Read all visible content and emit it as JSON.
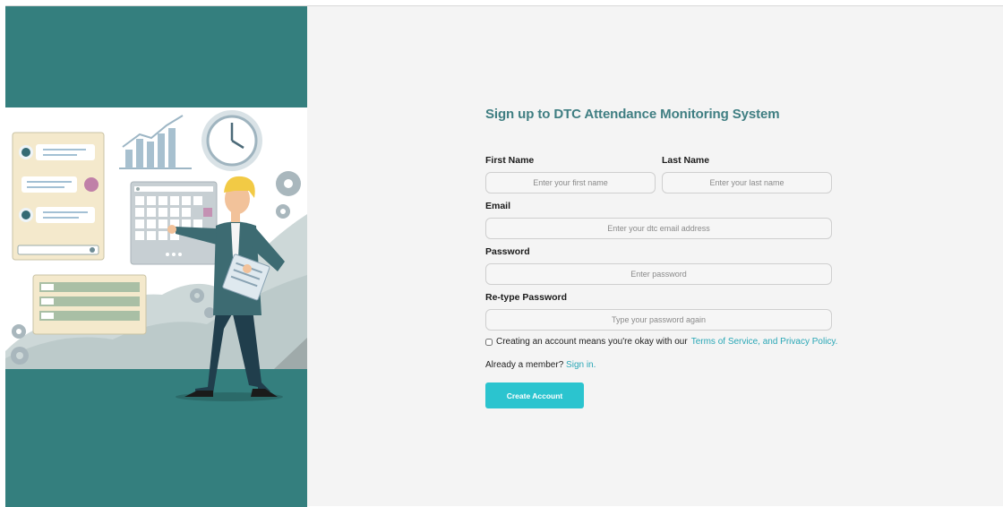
{
  "form": {
    "title": "Sign up to DTC Attendance Monitoring System",
    "first_name_label": "First Name",
    "first_name_placeholder": "Enter your first name",
    "first_name_value": "",
    "last_name_label": "Last Name",
    "last_name_placeholder": "Enter your last name",
    "last_name_value": "",
    "email_label": "Email",
    "email_placeholder": "Enter your dtc email address",
    "email_value": "",
    "password_label": "Password",
    "password_placeholder": "Enter password",
    "retype_label": "Re-type Password",
    "retype_placeholder": "Type your password again",
    "terms_text": "Creating an account means you're okay with our",
    "terms_link": "Terms of Service, and Privacy Policy.",
    "terms_checked": false,
    "member_text": "Already a member?",
    "signin_link": "Sign in.",
    "submit_label": "Create Account"
  },
  "colors": {
    "panel_teal": "#347f7e",
    "accent_cyan": "#2bc4cf",
    "link": "#2aa7b6",
    "title": "#3f7e82"
  },
  "illustration": {
    "subject": "office-worker-with-clipboard",
    "icons": [
      "chat-card-icon",
      "bar-chart-icon",
      "clock-icon",
      "calendar-icon",
      "gear-icon",
      "document-list-icon"
    ]
  }
}
